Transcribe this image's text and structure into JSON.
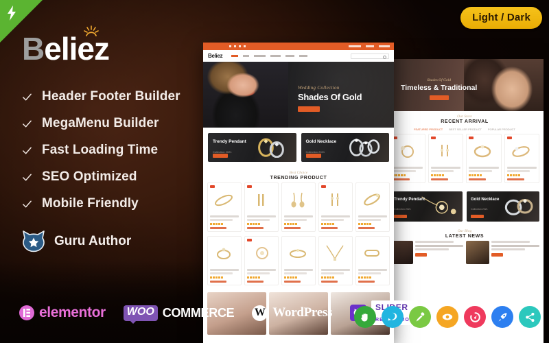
{
  "badge": {
    "theme_toggle": "Light / Dark",
    "ribbon_icon": "lightning-bolt-icon"
  },
  "brand": {
    "logo_b": "B",
    "logo_rest": "eliez",
    "sparkle_icon": "sparkle-icon"
  },
  "features": [
    {
      "label": "Header Footer Builder",
      "icon": "check-icon"
    },
    {
      "label": "MegaMenu Builder",
      "icon": "check-icon"
    },
    {
      "label": "Fast Loading Time",
      "icon": "check-icon"
    },
    {
      "label": "SEO Optimized",
      "icon": "check-icon"
    },
    {
      "label": "Mobile Friendly",
      "icon": "check-icon"
    }
  ],
  "author": {
    "label": "Guru Author",
    "icon": "cat-star-badge-icon"
  },
  "brands": [
    {
      "name": "elementor",
      "mark": "elementor-icon"
    },
    {
      "name": "WOO",
      "suffix": "COMMERCE",
      "mark": "woocommerce-icon"
    },
    {
      "name": "WordPress",
      "mark": "wordpress-icon"
    },
    {
      "name": "SLIDER",
      "suffix": "REVOLUTION",
      "mark": "slider-revolution-icon"
    }
  ],
  "feature_circles": [
    {
      "name": "drag-drop-hand-icon",
      "color": "#35a93b"
    },
    {
      "name": "chat-support-icon",
      "color": "#21b5e0"
    },
    {
      "name": "microphone-icon",
      "color": "#7ac943"
    },
    {
      "name": "eye-preview-icon",
      "color": "#f5a623"
    },
    {
      "name": "speed-gauge-icon",
      "color": "#ef3a5d"
    },
    {
      "name": "rocket-icon",
      "color": "#2d7ff0"
    },
    {
      "name": "share-nodes-icon",
      "color": "#2cc8bd"
    }
  ],
  "light_mockup": {
    "nav_logo": "Beliez",
    "nav_items": [
      "HOME",
      "SHOP",
      "CATEGORIES",
      "PRODUCTS",
      "PORTFOLIO",
      "ELEMENTS"
    ],
    "search_placeholder": "Search here...",
    "hero": {
      "script": "Wedding Collection",
      "title": "Shades Of Gold",
      "cta": "SHOP NOW"
    },
    "promos": [
      {
        "title": "Trendy Pendant",
        "subtitle": "Collection 2021",
        "cta": "SHOP NOW"
      },
      {
        "title": "Gold Necklace",
        "subtitle": "Collection 2021",
        "cta": "SHOP NOW"
      }
    ],
    "section": {
      "script": "Best Choice",
      "title": "TRENDING PRODUCT"
    }
  },
  "dark_mockup": {
    "hero": {
      "script": "Shades Of Gold",
      "title": "Timeless & Traditional",
      "cta": "SHOP NOW"
    },
    "section": {
      "script": "Our Store",
      "title": "RECENT ARRIVAL"
    },
    "tabs": [
      "FEATURED PRODUCT",
      "BEST SELLER PRODUCT",
      "POPULAR PRODUCT"
    ],
    "promos": [
      {
        "title": "Trendy Pendant",
        "subtitle": "Collection 2021",
        "cta": "SHOP NOW"
      },
      {
        "title": "Gold Necklace",
        "subtitle": "Collection 2021",
        "cta": "SHOP NOW"
      }
    ],
    "news_section": {
      "script": "Our Blog",
      "title": "LATEST NEWS"
    }
  }
}
